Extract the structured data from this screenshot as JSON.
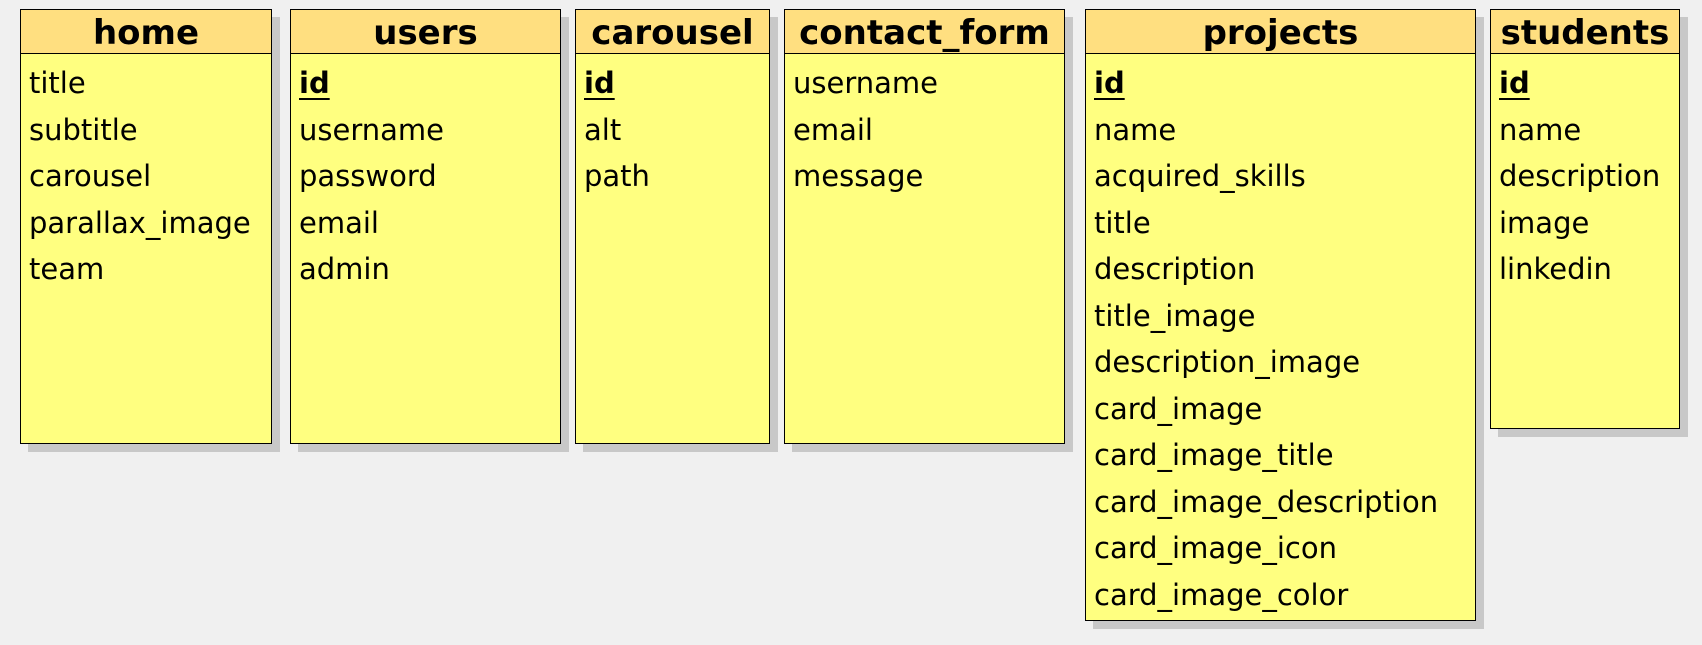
{
  "tables": [
    {
      "name": "home",
      "fields": [
        {
          "label": "title",
          "pk": false
        },
        {
          "label": "subtitle",
          "pk": false
        },
        {
          "label": "carousel",
          "pk": false
        },
        {
          "label": "parallax_image",
          "pk": false
        },
        {
          "label": "team",
          "pk": false
        }
      ]
    },
    {
      "name": "users",
      "fields": [
        {
          "label": "id",
          "pk": true
        },
        {
          "label": "username",
          "pk": false
        },
        {
          "label": "password",
          "pk": false
        },
        {
          "label": "email",
          "pk": false
        },
        {
          "label": "admin",
          "pk": false
        }
      ]
    },
    {
      "name": "carousel",
      "fields": [
        {
          "label": "id",
          "pk": true
        },
        {
          "label": "alt",
          "pk": false
        },
        {
          "label": "path",
          "pk": false
        }
      ]
    },
    {
      "name": "contact_form",
      "fields": [
        {
          "label": "username",
          "pk": false
        },
        {
          "label": "email",
          "pk": false
        },
        {
          "label": "message",
          "pk": false
        }
      ]
    },
    {
      "name": "projects",
      "fields": [
        {
          "label": "id",
          "pk": true
        },
        {
          "label": "name",
          "pk": false
        },
        {
          "label": "acquired_skills",
          "pk": false
        },
        {
          "label": "title",
          "pk": false
        },
        {
          "label": "description",
          "pk": false
        },
        {
          "label": "title_image",
          "pk": false
        },
        {
          "label": "description_image",
          "pk": false
        },
        {
          "label": "card_image",
          "pk": false
        },
        {
          "label": "card_image_title",
          "pk": false
        },
        {
          "label": "card_image_description",
          "pk": false
        },
        {
          "label": "card_image_icon",
          "pk": false
        },
        {
          "label": "card_image_color",
          "pk": false
        }
      ]
    },
    {
      "name": "students",
      "fields": [
        {
          "label": "id",
          "pk": true
        },
        {
          "label": "name",
          "pk": false
        },
        {
          "label": "description",
          "pk": false
        },
        {
          "label": "image",
          "pk": false
        },
        {
          "label": "linkedin",
          "pk": false
        }
      ]
    }
  ],
  "colors": {
    "header": "#ffdf80",
    "body": "#ffff80",
    "shadow": "#c8c8c8",
    "background": "#f0f0f0"
  }
}
